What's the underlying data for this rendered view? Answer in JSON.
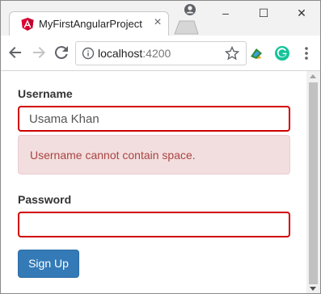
{
  "browser": {
    "tab_title": "MyFirstAngularProject",
    "tab_close_glyph": "×",
    "window_controls": [
      "–",
      "☐",
      "✕"
    ],
    "address": {
      "host": "localhost",
      "port": ":4200"
    },
    "icons": [
      "angular-favicon",
      "close-icon",
      "new-tab-icon",
      "profile-icon",
      "back-arrow-icon",
      "forward-arrow-icon",
      "reload-icon",
      "info-icon",
      "star-icon",
      "extension-icon",
      "grammarly-icon",
      "menu-dots-icon"
    ]
  },
  "form": {
    "username_label": "Username",
    "username_value": "Usama Khan",
    "username_error": "Username cannot contain space.",
    "password_label": "Password",
    "password_value": "",
    "submit_label": "Sign Up"
  },
  "colors": {
    "error_border": "#d00000",
    "alert_bg": "#f2dede",
    "alert_text": "#a94442",
    "primary_button": "#337ab7"
  }
}
